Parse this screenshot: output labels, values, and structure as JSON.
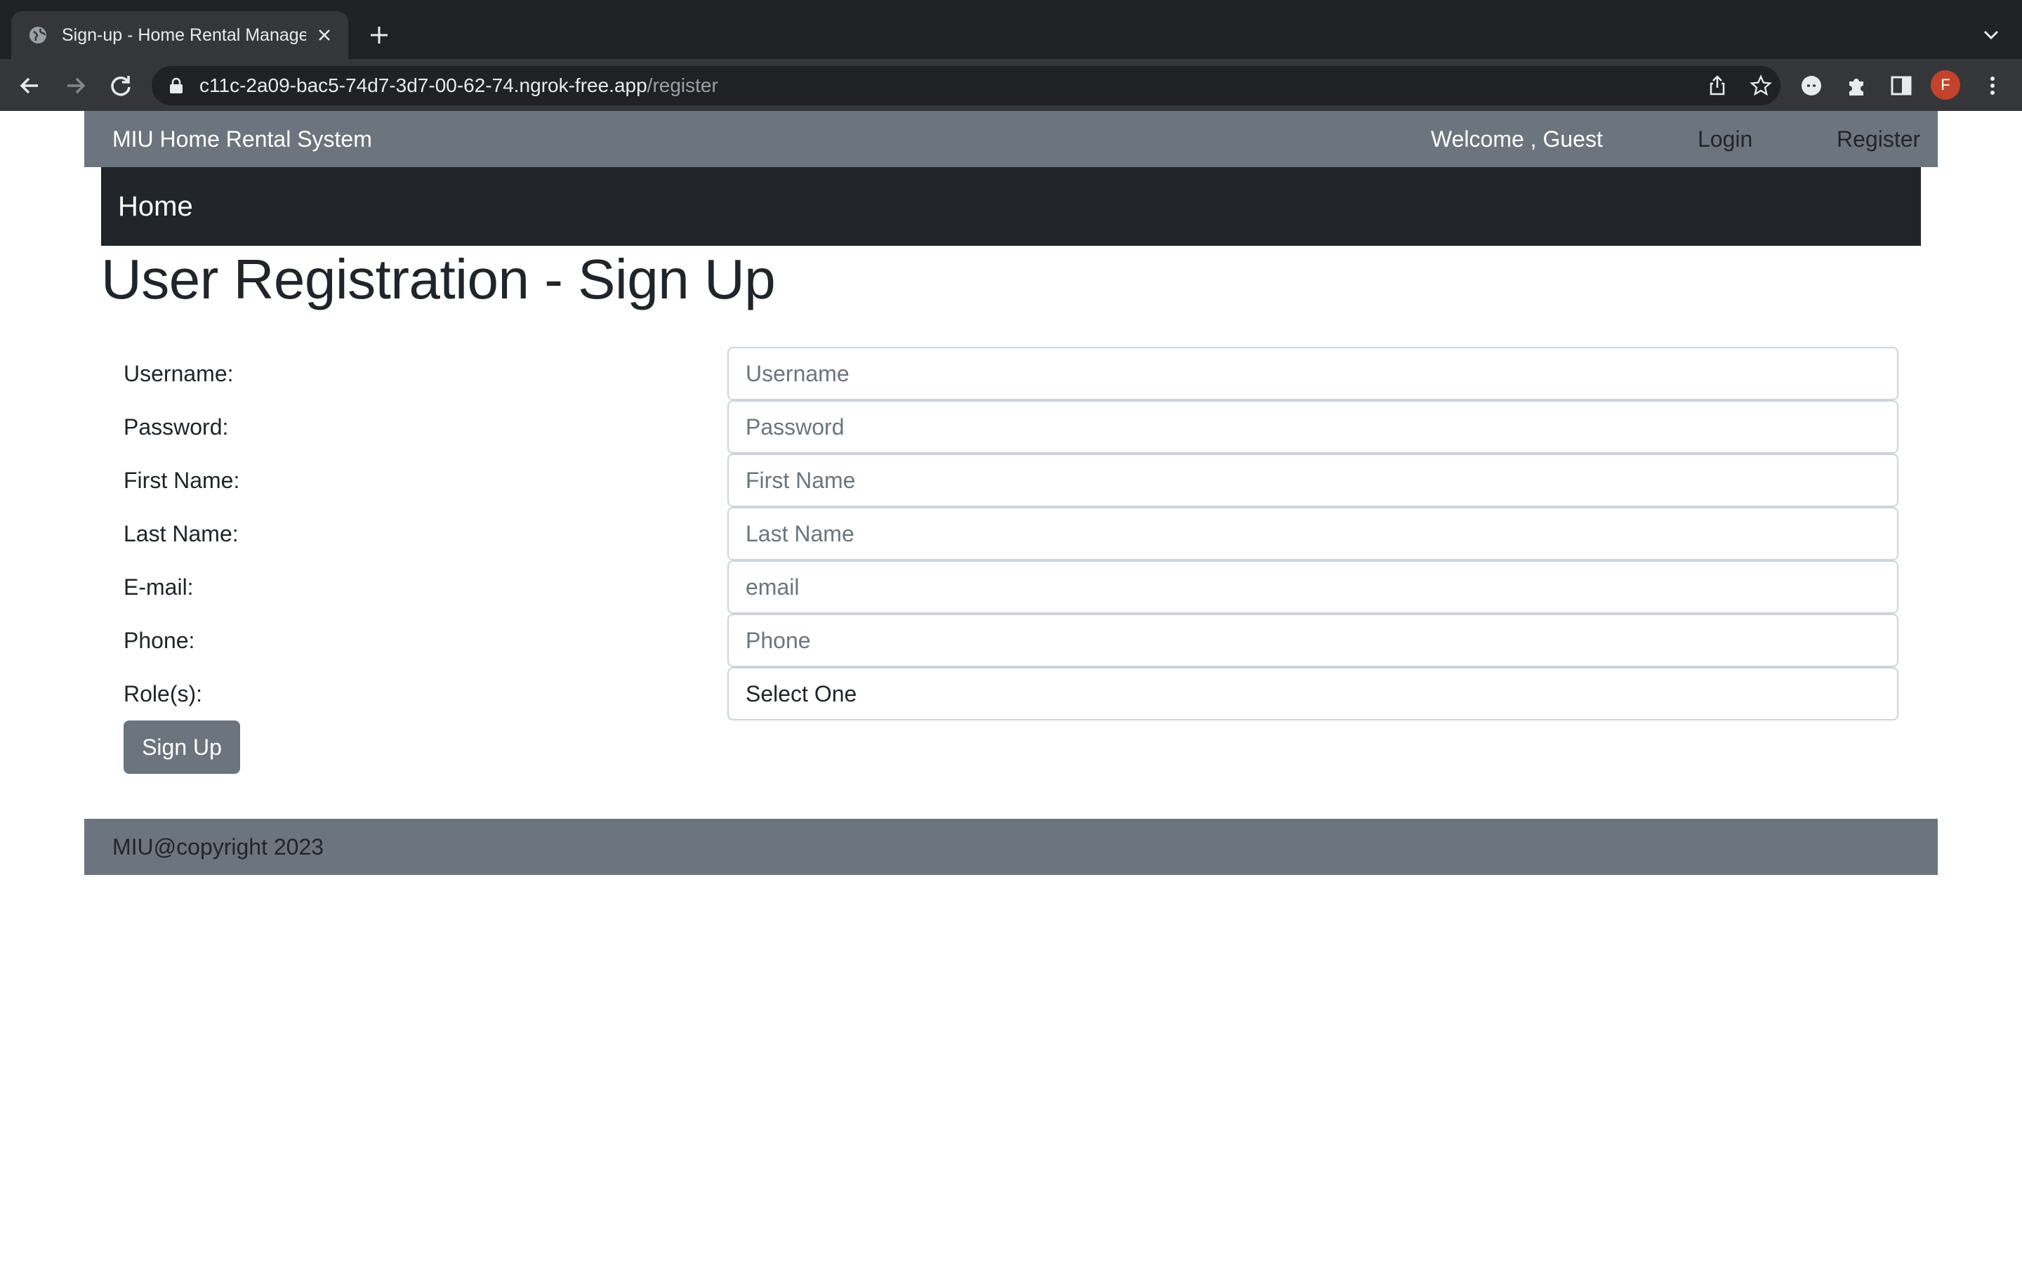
{
  "browser": {
    "tab": {
      "title": "Sign-up - Home Rental Management",
      "favicon": "globe-icon"
    },
    "url": {
      "host": "c11c-2a09-bac5-74d7-3d7-00-62-74.ngrok-free.app",
      "path": "/register"
    },
    "profile_initial": "F",
    "profile_color": "#c5422a"
  },
  "navbar": {
    "brand": "MIU Home Rental System",
    "welcome": "Welcome , Guest",
    "links": {
      "login": "Login",
      "register": "Register"
    },
    "color": "#6c757d"
  },
  "subnav": {
    "home": "Home",
    "color": "#212529"
  },
  "page_title": "User Registration - Sign Up",
  "form": {
    "fields": [
      {
        "label": "Username:",
        "placeholder": "Username",
        "value": ""
      },
      {
        "label": "Password:",
        "placeholder": "Password",
        "value": ""
      },
      {
        "label": "First Name:",
        "placeholder": "First Name",
        "value": ""
      },
      {
        "label": "Last Name:",
        "placeholder": "Last Name",
        "value": ""
      },
      {
        "label": "E-mail:",
        "placeholder": "email",
        "value": ""
      },
      {
        "label": "Phone:",
        "placeholder": "Phone",
        "value": ""
      }
    ],
    "role": {
      "label": "Role(s):",
      "selected": "Select One"
    },
    "submit_label": "Sign Up"
  },
  "footer": {
    "text": "MIU@copyright 2023"
  }
}
